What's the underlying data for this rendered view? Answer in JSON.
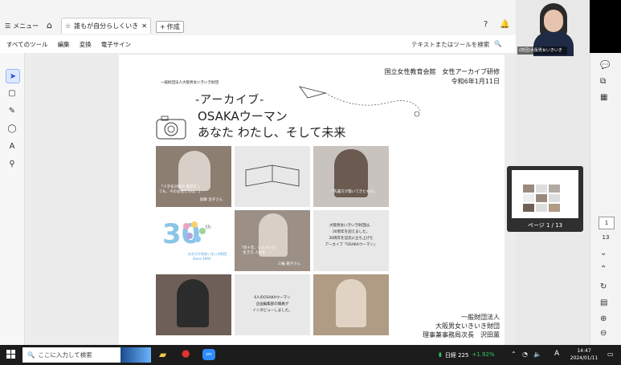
{
  "browser": {
    "menu_label": "メニュー",
    "tab_title": "誰もが自分らしくいきい…",
    "new_tab_label": "作成"
  },
  "toolbar": {
    "items": [
      "すべてのツール",
      "編集",
      "変換",
      "電子サイン"
    ],
    "search_placeholder": "テキストまたはツールを検索"
  },
  "document": {
    "org_top": "一般財団法人大阪男女いきいき財団",
    "header_right_1": "国立女性教育会館　女性アーカイブ研修",
    "header_right_2": "令和6年1月11日",
    "title_1": "-アーカイブ-",
    "title_2": "OSAKAウーマン",
    "title_3": "あなた わたし、そして未来",
    "caption_1": "「少子化対策の 要求をしても、今の女性たちは…」",
    "name_1": "加藤 治子さん",
    "caption_2": "「先輩方が築いてきたもの」",
    "caption_4": "「何十年、いただいた 生き方 人生を…」",
    "name_4": "三輪 嘉子さん",
    "text_5_1": "大阪男女いきいき財団は、",
    "text_5_2": "30周年を迎えました。",
    "text_5_3": "30周年を記念に立ち上げた",
    "text_5_4": "アーカイブ「OSAKAウーマン」",
    "logo_num": "30",
    "logo_sub": "th",
    "logo_text_1": "おおさか男女いきいき財団",
    "logo_text_2": "Since 1993",
    "text_8_1": "6人のOSAKAウーマン",
    "text_8_2": "企画編集部の職員が",
    "text_8_3": "インタビューしました。",
    "footer_1": "一般財団法人",
    "footer_2": "大阪男女いきいき財団",
    "footer_3": "理事兼事務局次長　沢田薫"
  },
  "webcam": {
    "label": "(財団)大阪男女いきいき"
  },
  "thumbnail": {
    "page_label": "ページ 1 / 13"
  },
  "pager": {
    "current": "1",
    "total": "13"
  },
  "taskbar": {
    "search_placeholder": "ここに入力して検索",
    "stock_name": "日経 225",
    "stock_change": "+1.92%",
    "ime": "A",
    "time": "14:47",
    "date": "2024/01/11"
  },
  "colors": {
    "accent": "#1a4fd6",
    "taskbar": "#1c1c1c",
    "stock_up": "#32c864"
  }
}
